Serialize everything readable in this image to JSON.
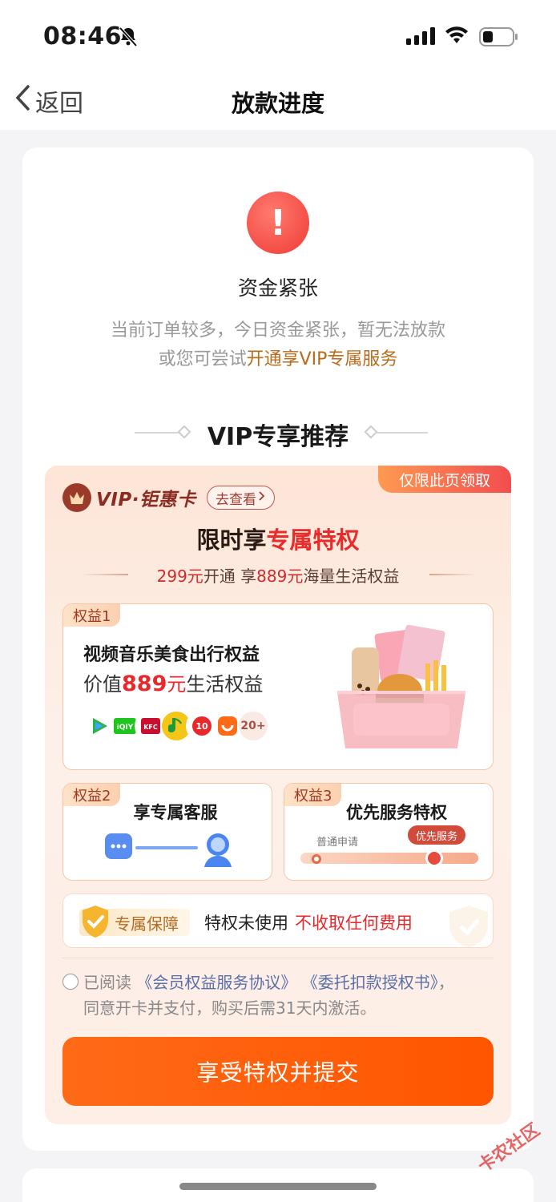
{
  "status_bar": {
    "time": "08:46"
  },
  "nav": {
    "back_label": "返回",
    "title": "放款进度"
  },
  "status": {
    "title": "资金紧张",
    "line1": "当前订单较多，今日资金紧张，暂无法放款",
    "line2_prefix": "或您可尝试",
    "line2_link": "开通享VIP专属服务"
  },
  "recommend": {
    "title": "VIP专享推荐"
  },
  "vip": {
    "ribbon": "仅限此页领取",
    "brand": "VIP·钜惠卡",
    "view_btn": "去查看",
    "promo_prefix": "限时享",
    "promo_highlight": "专属特权",
    "sub_price": "299元",
    "sub_mid": "开通 享",
    "sub_value": "889元",
    "sub_suffix": "海量生活权益",
    "benefit1": {
      "tag": "权益1",
      "title": "视频音乐美食出行权益",
      "value_prefix": "价值",
      "value_num": "889",
      "value_unit": "元",
      "value_suffix": "生活权益",
      "apps": [
        {
          "name": "tencent-video-icon",
          "color": "#2fb04a"
        },
        {
          "name": "iqiyi-icon",
          "color": "#1ec51e"
        },
        {
          "name": "kfc-icon",
          "color": "#c8102e"
        },
        {
          "name": "qq-music-icon",
          "color": "#f5c518"
        },
        {
          "name": "app-red-icon",
          "color": "#e8282b"
        },
        {
          "name": "didi-icon",
          "color": "#ff6a17"
        }
      ],
      "more": "20+"
    },
    "benefit2": {
      "tag": "权益2",
      "title": "享专属客服"
    },
    "benefit3": {
      "tag": "权益3",
      "title": "优先服务特权",
      "normal_label": "普通申请",
      "priority_label": "优先服务"
    },
    "guarantee": {
      "badge": "专属保障",
      "text": "特权未使用",
      "red_text": "不收取任何费用"
    },
    "agreement": {
      "prefix": "已阅读",
      "link1": "《会员权益服务协议》",
      "link2": "《委托扣款授权书》",
      "suffix": "，",
      "line2": "同意开卡并支付，购买后需31天内激活。"
    },
    "submit": "享受特权并提交"
  },
  "watermark": "卡农社区"
}
